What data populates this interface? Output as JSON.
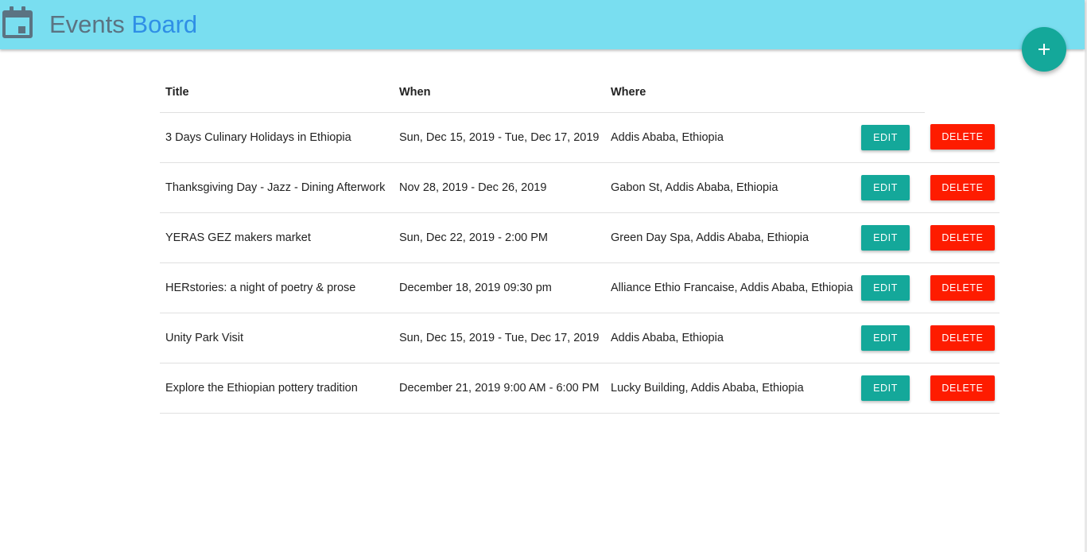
{
  "header": {
    "title_part1": "Events",
    "title_part2": "Board",
    "icon": "calendar-icon",
    "background_color": "#79def0"
  },
  "fab": {
    "icon": "plus-icon",
    "color": "#14a89a"
  },
  "table": {
    "columns": [
      "Title",
      "When",
      "Where"
    ],
    "rows": [
      {
        "title": "3 Days Culinary Holidays in Ethiopia",
        "when": "Sun, Dec 15, 2019 - Tue, Dec 17, 2019",
        "where": "Addis Ababa, Ethiopia"
      },
      {
        "title": "Thanksgiving Day - Jazz - Dining Afterwork",
        "when": "Nov 28, 2019 - Dec 26, 2019",
        "where": "Gabon St, Addis Ababa, Ethiopia"
      },
      {
        "title": "YERAS GEZ makers market",
        "when": "Sun, Dec 22, 2019 - 2:00 PM",
        "where": "Green Day Spa, Addis Ababa, Ethiopia"
      },
      {
        "title": "HERstories: a night of poetry & prose",
        "when": "December 18, 2019 09:30 pm",
        "where": "Alliance Ethio Francaise, Addis Ababa, Ethiopia"
      },
      {
        "title": "Unity Park Visit",
        "when": "Sun, Dec 15, 2019 - Tue, Dec 17, 2019",
        "where": "Addis Ababa, Ethiopia"
      },
      {
        "title": "Explore the Ethiopian pottery tradition",
        "when": "December 21, 2019 9:00 AM - 6:00 PM",
        "where": "Lucky Building, Addis Ababa, Ethiopia"
      }
    ]
  },
  "actions": {
    "edit_label": "EDIT",
    "delete_label": "DELETE",
    "edit_color": "#14a89a",
    "delete_color": "#fe1c00"
  }
}
